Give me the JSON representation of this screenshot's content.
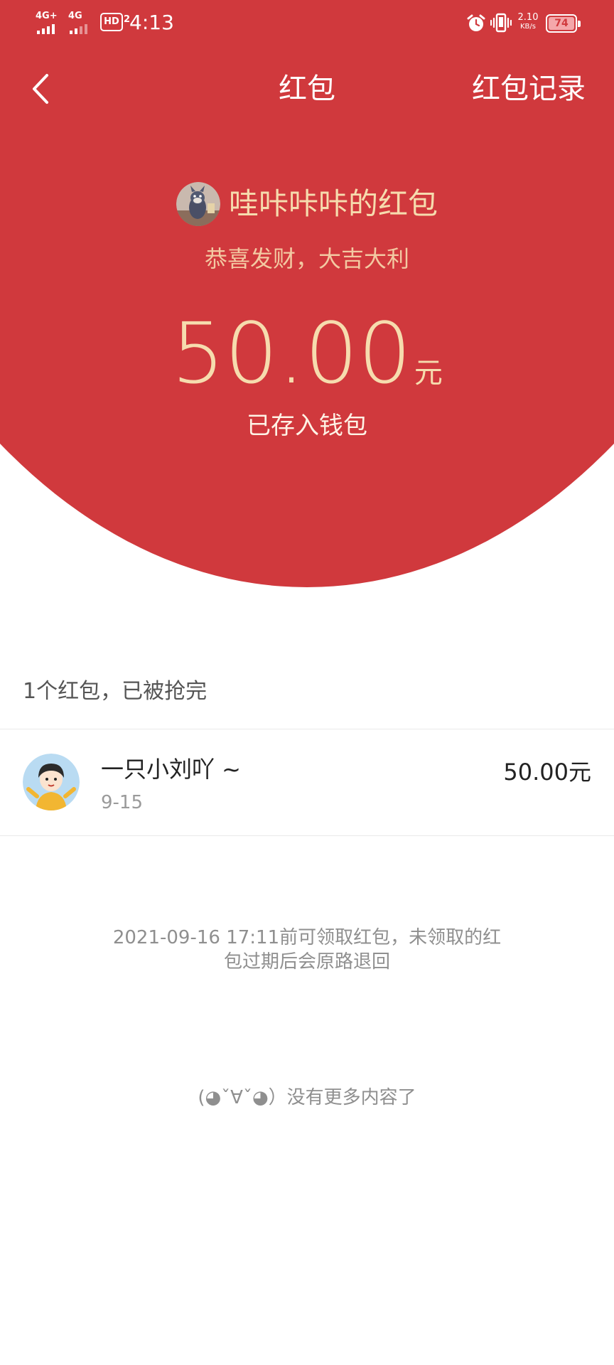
{
  "status_bar": {
    "sim1_network": "4G+",
    "sim2_network": "4G",
    "hd_badge": "HD",
    "hd_sub": "2",
    "time": "4:13",
    "net_speed_value": "2.10",
    "net_speed_unit": "KB/s",
    "battery_level": "74"
  },
  "nav": {
    "title": "红包",
    "records_label": "红包记录"
  },
  "packet": {
    "sender_name": "哇咔咔咔的红包",
    "greeting": "恭喜发财，大吉大利",
    "amount": "50.00",
    "amount_unit": "元",
    "status": "已存入钱包"
  },
  "list": {
    "summary": "1个红包，已被抢完",
    "rows": [
      {
        "name": "一只小刘吖 ~",
        "date": "9-15",
        "amount": "50.00元"
      }
    ]
  },
  "note": "2021-09-16 17:11前可领取红包，未领取的红包过期后会原路退回",
  "end_text": "(◕ˇ∀ˇ◕）没有更多内容了",
  "colors": {
    "header_red": "#d0393d",
    "gold_text": "#f6dcae",
    "greeting_text": "#f3c9a2"
  }
}
